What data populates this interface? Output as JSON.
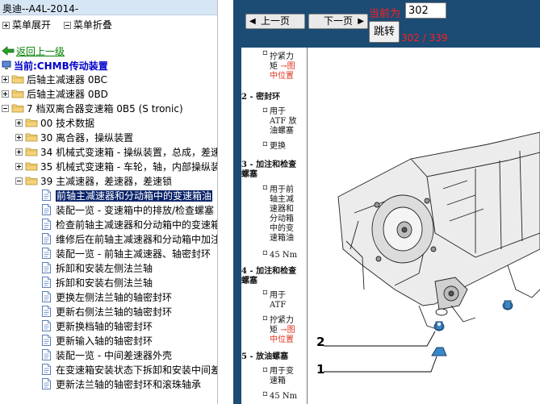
{
  "window_title": "奥迪--A4L-2014-",
  "toolbar": {
    "expand_menu": "菜单展开",
    "collapse_menu": "菜单折叠"
  },
  "back_link": "返回上一级",
  "current_node": "当前:CHMB传动装置",
  "tree": {
    "top": [
      {
        "label": "后轴主减速器 0BC",
        "expanded": false
      },
      {
        "label": "后轴主减速器 0BD",
        "expanded": false
      },
      {
        "label": "7 档双离合器变速箱 0B5 (S tronic)",
        "expanded": true
      }
    ],
    "children": [
      {
        "label": "00 技术数据",
        "expanded": false
      },
      {
        "label": "30 离合器，操纵装置",
        "expanded": false
      },
      {
        "label": "34 机械式变速箱 - 操纵装置，总成，差速",
        "expanded": false
      },
      {
        "label": "35 机械式变速箱 - 车轮，轴，内部操纵装",
        "expanded": false
      },
      {
        "label": "39 主减速器，差速器，差速锁",
        "expanded": true
      }
    ],
    "documents": [
      {
        "label": "前轴主减速器和分动箱中的变速箱油",
        "selected": true
      },
      {
        "label": "装配一览 - 变速箱中的排放/检查螺塞",
        "selected": false
      },
      {
        "label": "检查前轴主减速器和分动箱中的变速箱",
        "selected": false
      },
      {
        "label": "维修后在前轴主减速器和分动箱中加注",
        "selected": false
      },
      {
        "label": "装配一览 - 前轴主减速器、轴密封环",
        "selected": false
      },
      {
        "label": "拆卸和安装左侧法兰轴",
        "selected": false
      },
      {
        "label": "拆卸和安装右侧法兰轴",
        "selected": false
      },
      {
        "label": "更换左侧法兰轴的轴密封环",
        "selected": false
      },
      {
        "label": "更新右侧法兰轴的轴密封环",
        "selected": false
      },
      {
        "label": "更新换档轴的轴密封环",
        "selected": false
      },
      {
        "label": "更新输入轴的轴密封环",
        "selected": false
      },
      {
        "label": "装配一览 - 中间差速器外壳",
        "selected": false
      },
      {
        "label": "在变速箱安装状态下拆卸和安装中间差",
        "selected": false
      },
      {
        "label": "更新法兰轴的轴密封环和滚珠轴承",
        "selected": false
      }
    ]
  },
  "nav": {
    "prev_label": "上一页",
    "next_label": "下一页",
    "current_label": "当前为",
    "page_value": "302",
    "goto_label": "跳转",
    "page_count": "302 / 339"
  },
  "document": {
    "item_0": {
      "l1": "拧紧力",
      "l2": "矩",
      "link": "图",
      "l3": "中位置"
    },
    "item_2": {
      "heading": "2 - 密封环",
      "l1": "用于",
      "l2": "ATF 放",
      "l3": "油螺塞",
      "l4": "更换"
    },
    "item_3": {
      "heading1": "3 - 加注和检查",
      "heading2": "螺塞",
      "l1": "用于前",
      "l2": "轴主减",
      "l3": "速器和",
      "l4": "分动箱",
      "l5": "中的变",
      "l6": "速箱油",
      "torque": "45 Nm"
    },
    "item_4": {
      "heading1": "4 - 加注和检查",
      "heading2": "螺塞",
      "l1": "用于",
      "l2": "ATF",
      "l3": "拧紧力",
      "l4": "矩",
      "link": "图",
      "l5": "中位置"
    },
    "item_5": {
      "heading": "5 - 放油螺塞",
      "l1": "用于变",
      "l2": "速箱",
      "torque": "45 Nm"
    },
    "callouts": [
      "2",
      "1"
    ]
  },
  "colors": {
    "nav_bar": "#1c4b73",
    "selection": "#0a246a",
    "red_text": "#ff2020",
    "link_green": "#008000",
    "current_blue": "#0000cc"
  }
}
